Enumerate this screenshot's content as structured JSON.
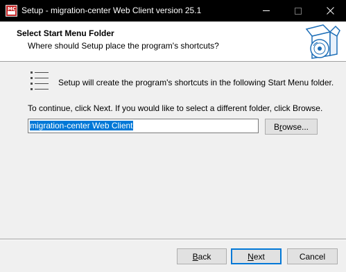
{
  "window": {
    "title": "Setup - migration-center Web Client version 25.1",
    "icon": "mc-setup-icon"
  },
  "header": {
    "title": "Select Start Menu Folder",
    "subtitle": "Where should Setup place the program's shortcuts?",
    "icon": "setup-box-cd-icon"
  },
  "body": {
    "info": "Setup will create the program's shortcuts in the following Start Menu folder.",
    "continue": "To continue, click Next. If you would like to select a different folder, click Browse.",
    "folder_value": "migration-center Web Client",
    "browse_label_pre": "B",
    "browse_label_u": "r",
    "browse_label_post": "owse..."
  },
  "footer": {
    "back_u": "B",
    "back_rest": "ack",
    "next_u": "N",
    "next_rest": "ext",
    "cancel": "Cancel"
  }
}
